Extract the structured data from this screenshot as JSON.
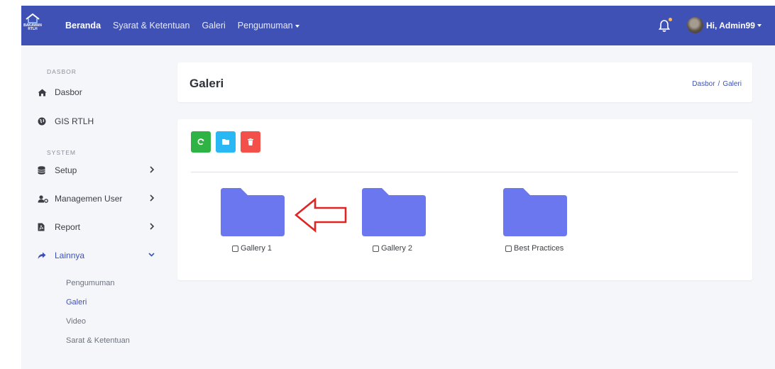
{
  "brand": {
    "logo_text_line1": "BAKAWAN",
    "logo_text_line2": "RTLH"
  },
  "topnav": {
    "items": [
      {
        "label": "Beranda"
      },
      {
        "label": "Syarat & Ketentuan"
      },
      {
        "label": "Galeri"
      },
      {
        "label": "Pengumuman"
      }
    ],
    "user_label": "Hi, Admin99"
  },
  "sidebar": {
    "heading_dasbor": "DASBOR",
    "heading_system": "SYSTEM",
    "items": [
      {
        "label": "Dasbor",
        "icon": "home-icon"
      },
      {
        "label": "GIS RTLH",
        "icon": "globe-icon"
      },
      {
        "label": "Setup",
        "icon": "database-icon"
      },
      {
        "label": "Managemen User",
        "icon": "users-cog-icon"
      },
      {
        "label": "Report",
        "icon": "pdf-file-icon"
      },
      {
        "label": "Lainnya",
        "icon": "share-icon"
      }
    ],
    "sub_items": [
      {
        "label": "Pengumuman"
      },
      {
        "label": "Galeri"
      },
      {
        "label": "Video"
      },
      {
        "label": "Sarat & Ketentuan"
      }
    ]
  },
  "header": {
    "title": "Galeri",
    "breadcrumb": [
      "Dasbor",
      "Galeri"
    ],
    "breadcrumb_sep": "/"
  },
  "toolbar": {
    "refresh_icon": "refresh-icon",
    "folder_icon": "folder-icon",
    "delete_icon": "trash-icon"
  },
  "folders": [
    {
      "label": "Gallery 1"
    },
    {
      "label": "Gallery 2"
    },
    {
      "label": "Best Practices"
    }
  ],
  "colors": {
    "primary": "#3f51b5",
    "folder": "#6a77ee",
    "success": "#2fb344",
    "info": "#2ab8f5",
    "danger": "#f3504a",
    "annotation_arrow": "#e02424"
  }
}
